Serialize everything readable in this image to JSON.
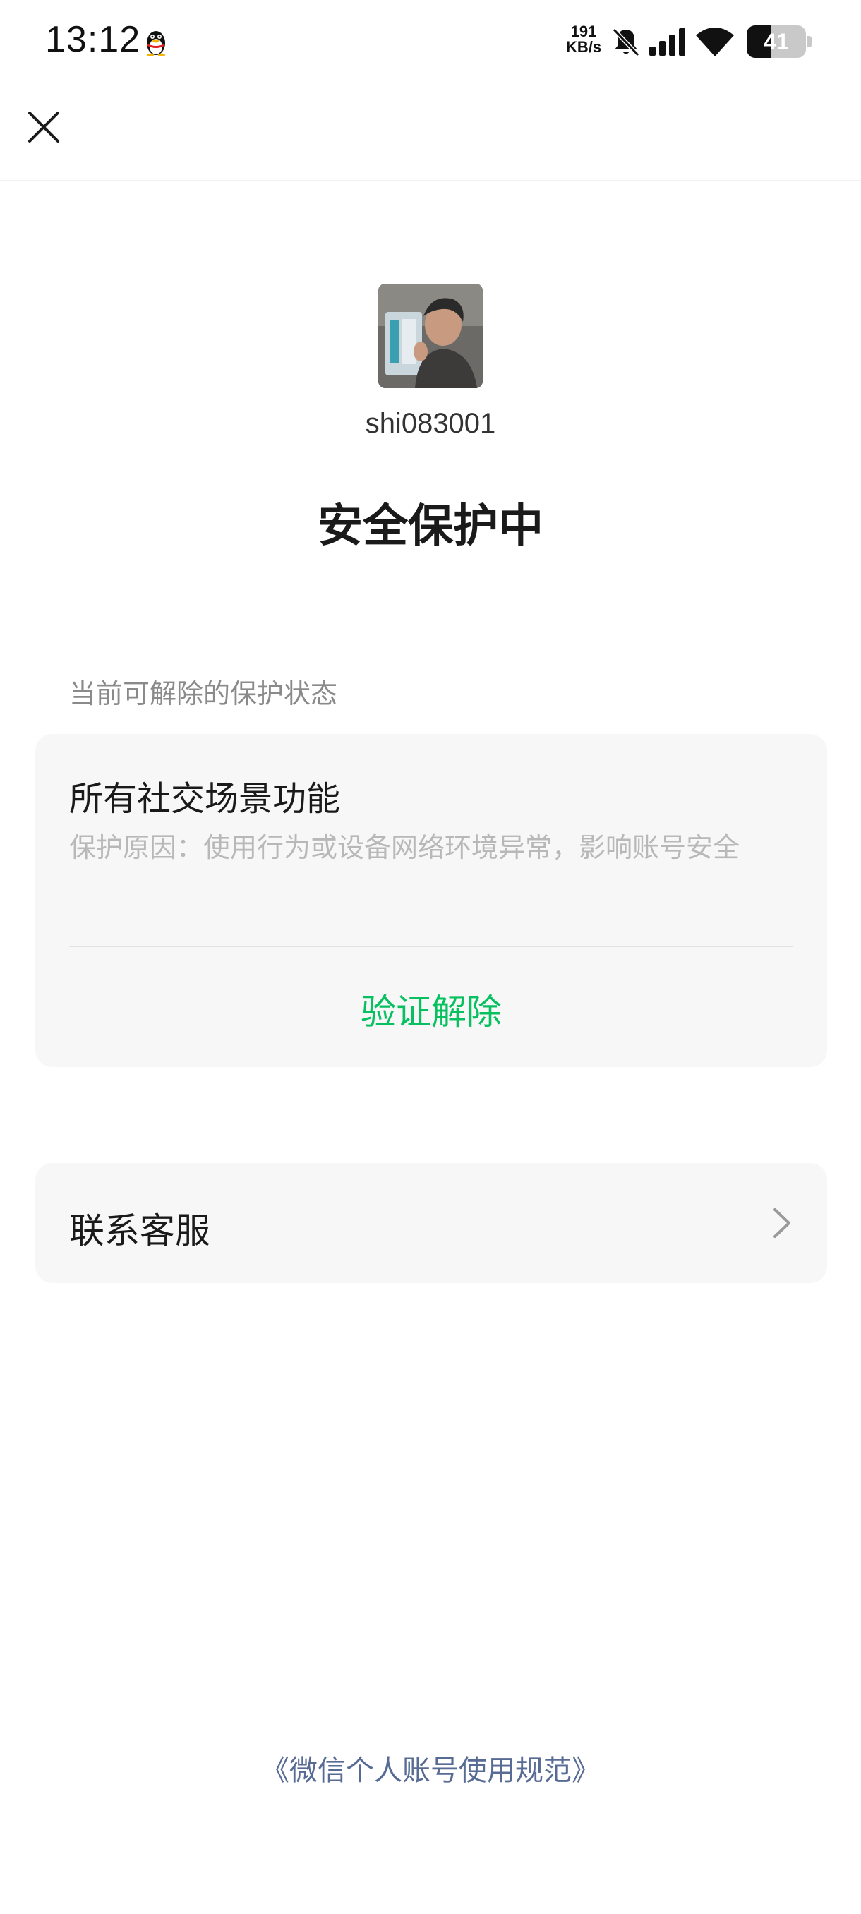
{
  "status_bar": {
    "time": "13:12",
    "net_speed_value": "191",
    "net_speed_unit": "KB/s",
    "battery_level": "41",
    "battery_fraction": 0.41,
    "icons": [
      "qq-penguin-icon",
      "mute-bell-icon",
      "signal-icon",
      "wifi-icon",
      "battery-icon"
    ]
  },
  "nav": {
    "close_icon": "close-icon"
  },
  "profile": {
    "username": "shi083001"
  },
  "page_title": "安全保护中",
  "section_label": "当前可解除的保护状态",
  "protection_card": {
    "title": "所有社交场景功能",
    "reason": "保护原因：使用行为或设备网络环境异常，影响账号安全",
    "action_label": "验证解除"
  },
  "contact": {
    "label": "联系客服",
    "chevron_icon": "chevron-right-icon"
  },
  "footer": {
    "link_label": "《微信个人账号使用规范》"
  },
  "colors": {
    "accent_green": "#07c160",
    "link_blue": "#576b95",
    "card_bg": "#f7f7f7"
  }
}
